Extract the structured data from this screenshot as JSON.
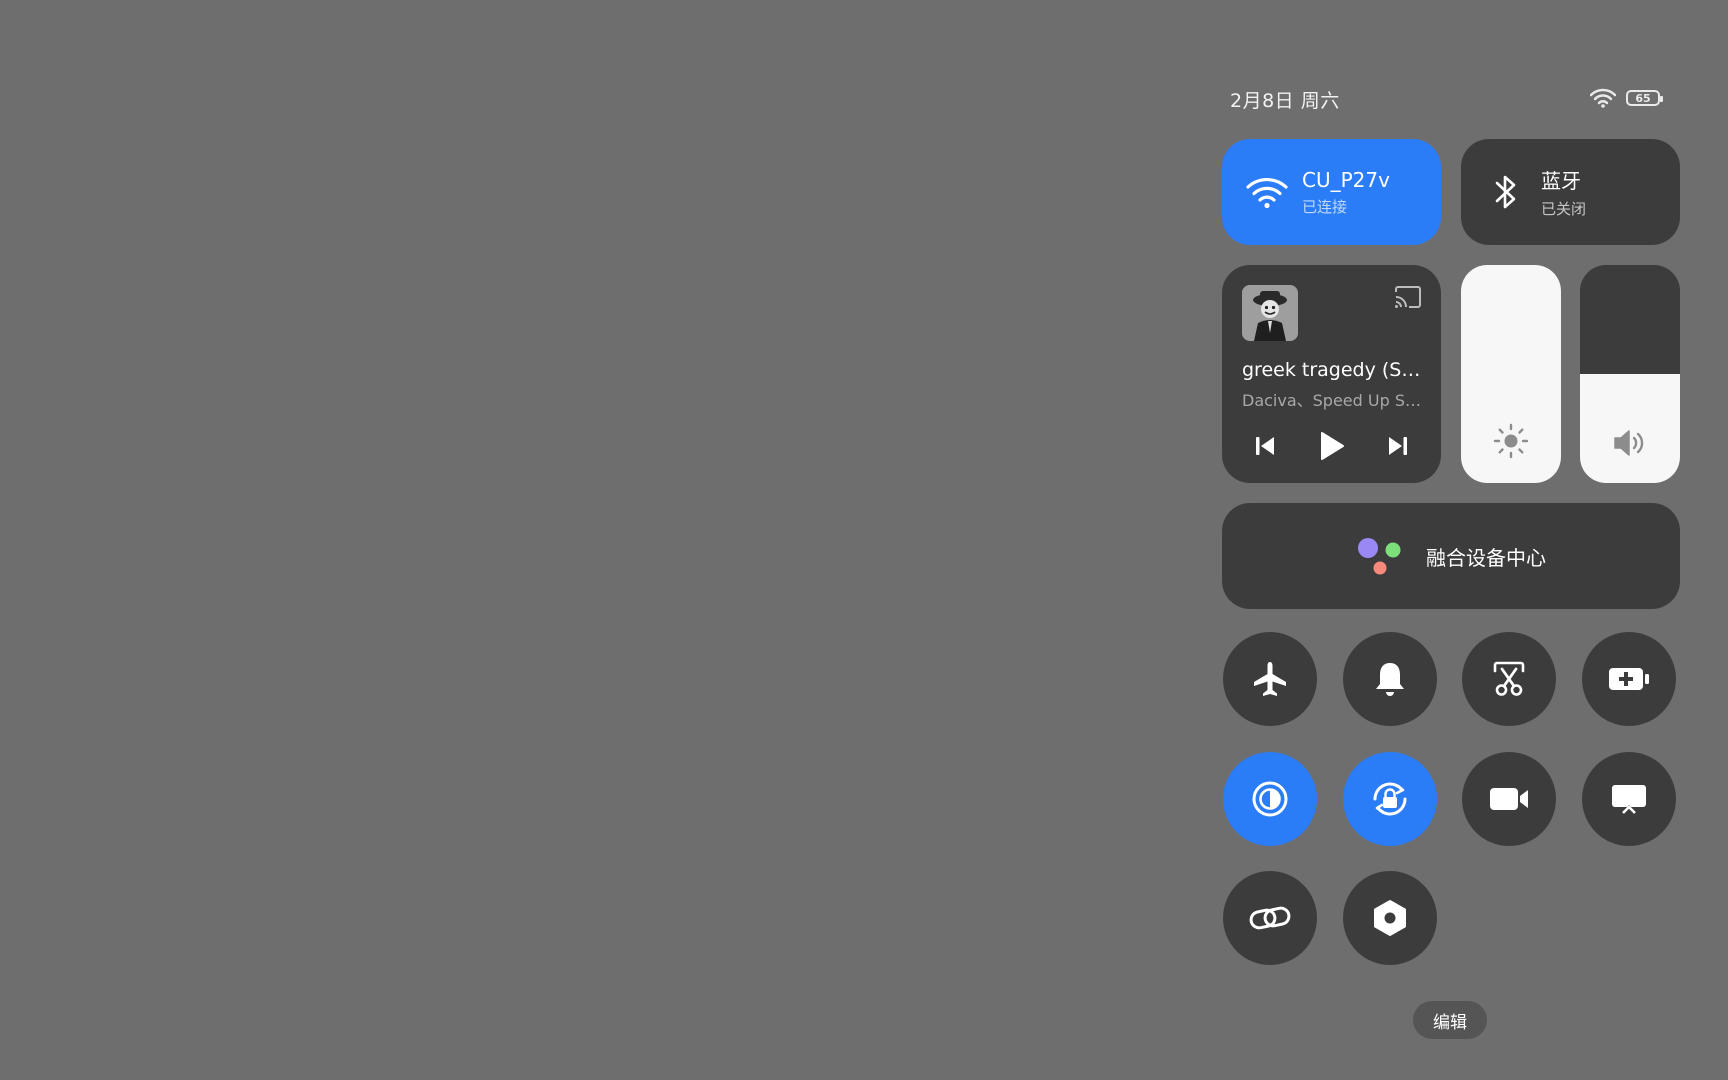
{
  "status": {
    "date": "2月8日 周六",
    "battery": "65"
  },
  "wifi": {
    "name": "CU_P27v",
    "status": "已连接"
  },
  "bluetooth": {
    "name": "蓝牙",
    "status": "已关闭"
  },
  "media": {
    "title": "greek tragedy (Sped Up)",
    "artist": "Daciva、Speed Up Songs"
  },
  "sliders": {
    "brightness_level": 1.0,
    "volume_level": 0.5
  },
  "fusion": {
    "label": "融合设备中心"
  },
  "toggles": [
    {
      "name": "airplane-mode",
      "icon": "airplane-icon",
      "active": false
    },
    {
      "name": "ring-mode",
      "icon": "bell-icon",
      "active": false
    },
    {
      "name": "screenshot",
      "icon": "scissors-icon",
      "active": false
    },
    {
      "name": "battery-saver",
      "icon": "battery-plus-icon",
      "active": false
    },
    {
      "name": "dark-mode",
      "icon": "contrast-icon",
      "active": true
    },
    {
      "name": "rotation-lock",
      "icon": "rotation-lock-icon",
      "active": true
    },
    {
      "name": "screen-record",
      "icon": "video-camera-icon",
      "active": false
    },
    {
      "name": "screen-cast",
      "icon": "cast-screen-icon",
      "active": false
    },
    {
      "name": "link-share",
      "icon": "link-icon",
      "active": false
    },
    {
      "name": "settings",
      "icon": "hex-nut-icon",
      "active": false
    }
  ],
  "colors": {
    "accent": "#2b7cf7",
    "tile": "#3c3c3c",
    "background": "#6e6e6e"
  },
  "edit_label": "编辑"
}
